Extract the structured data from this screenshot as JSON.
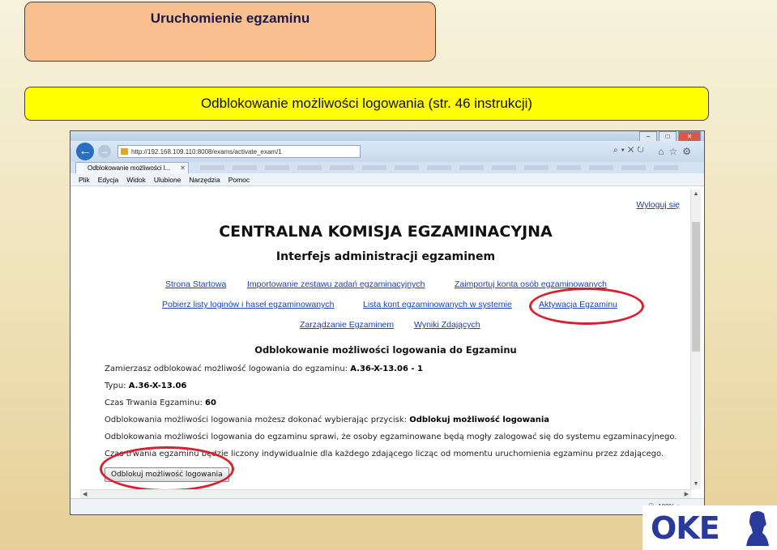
{
  "slide": {
    "title": "Uruchomienie egzaminu",
    "subtitle": "Odblokowanie możliwości logowania  (str. 46  instrukcji)"
  },
  "browser": {
    "url": "http://192.168.109.110:8008/exams/activate_exam/1",
    "tab_title": "Odblokowanie możliwości l...",
    "tab_close": "✕",
    "menu": [
      "Plik",
      "Edycja",
      "Widok",
      "Ulubione",
      "Narzędzia",
      "Pomoc"
    ],
    "zoom": "100%"
  },
  "page": {
    "logout": "Wyloguj się",
    "heading": "CENTRALNA KOMISJA EGZAMINACYJNA",
    "subheading": "Interfejs administracji egzaminem",
    "nav": {
      "start": "Strona Startowa",
      "import_tasks": "Importowanie zestawu zadań egzaminacyjnych",
      "import_accounts": "Zaimportuj konta osób egzaminowanych",
      "logins": "Pobierz listy loginów i haseł egzaminowanych",
      "accounts_list": "Lista kont egzaminowanych w systemie",
      "activation": "Aktywacja Egzaminu",
      "manage": "Zarządzanie Egzaminem",
      "results": "Wyniki Zdających"
    },
    "section_title": "Odblokowanie możliwości logowania do Egzaminu",
    "line1_text": "Zamierzasz odblokować możliwość logowania do egzaminu:",
    "line1_value": "A.36-X-13.06 - 1",
    "line2_text": "Typu:",
    "line2_value": "A.36-X-13.06",
    "line3_text": "Czas Trwania Egzaminu:",
    "line3_value": "60",
    "line4_text": "Odblokowania możliwości logowania możesz dokonać wybierając przycisk:",
    "line4_value": "Odblokuj możliwość logowania",
    "line5_text": "Odblokowania możliwości logowania do egzaminu sprawi, że osoby egzaminowane będą mogły zalogować się do systemu egzaminacyjnego.",
    "line6_text": "Czas trwania egzaminu będzie liczony indywidualnie dla każdego zdającego licząc od momentu uruchomienia egzaminu przez zdającego.",
    "unlock_button": "Odblokuj możliwość logowania"
  },
  "logo": {
    "text": "OKE"
  },
  "colors": {
    "title_bg": "#f9bf8f",
    "subtitle_bg": "#ffff00",
    "highlight": "#d82030",
    "link": "#1a3fb8"
  }
}
